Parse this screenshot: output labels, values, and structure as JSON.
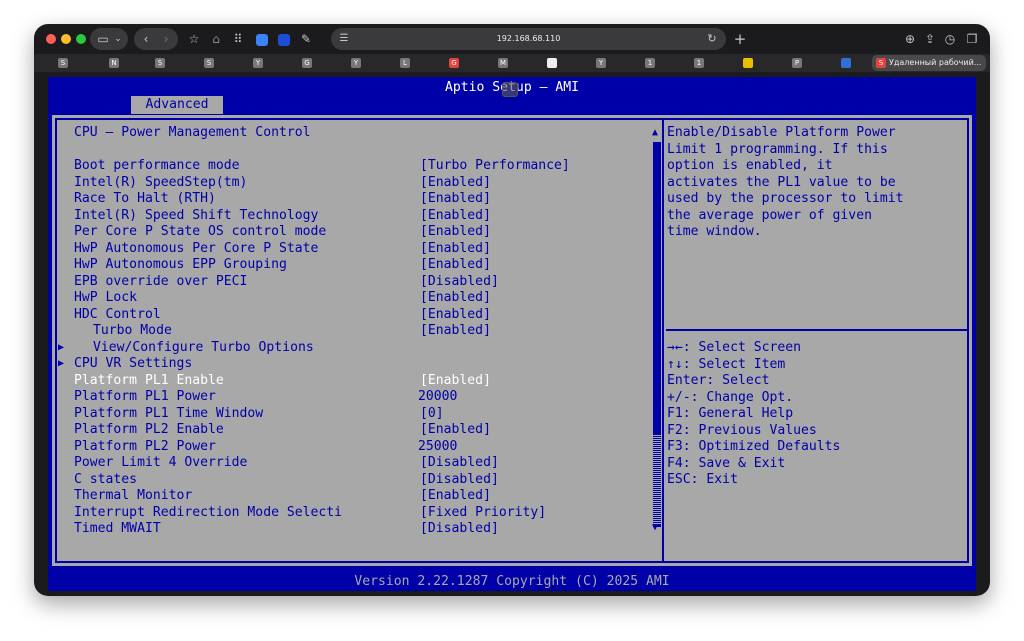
{
  "browser": {
    "url": "192.168.68.110",
    "tab_title": "Удаленный рабочий...",
    "favicons": [
      "S",
      "N",
      "S",
      "S",
      "Y",
      "G",
      "Y",
      "L",
      "G",
      "M",
      "",
      "Y",
      "1",
      "1",
      "",
      "P",
      ""
    ]
  },
  "bios": {
    "title": "Aptio Setup – AMI",
    "active_tab": "Advanced",
    "section_title": "CPU – Power Management Control",
    "items": [
      {
        "label": "Boot performance mode",
        "value": "[Turbo Performance]"
      },
      {
        "label": "Intel(R) SpeedStep(tm)",
        "value": "[Enabled]"
      },
      {
        "label": "Race To Halt (RTH)",
        "value": "[Enabled]"
      },
      {
        "label": "Intel(R) Speed Shift Technology",
        "value": "[Enabled]"
      },
      {
        "label": "Per Core P State OS control mode",
        "value": "[Enabled]"
      },
      {
        "label": "HwP Autonomous Per Core P State",
        "value": "[Enabled]"
      },
      {
        "label": "HwP Autonomous EPP Grouping",
        "value": "[Enabled]"
      },
      {
        "label": "EPB override over PECI",
        "value": "[Disabled]"
      },
      {
        "label": "HwP Lock",
        "value": "[Enabled]"
      },
      {
        "label": "HDC Control",
        "value": "[Enabled]"
      },
      {
        "label": "Turbo Mode",
        "value": "[Enabled]"
      },
      {
        "label": "View/Configure Turbo Options",
        "value": ""
      },
      {
        "label": "CPU VR Settings",
        "value": ""
      },
      {
        "label": "Platform PL1 Enable",
        "value": "[Enabled]"
      },
      {
        "label": "Platform PL1 Power",
        "value": "20000"
      },
      {
        "label": "Platform PL1 Time Window",
        "value": "[0]"
      },
      {
        "label": "Platform PL2 Enable",
        "value": "[Enabled]"
      },
      {
        "label": "Platform PL2 Power",
        "value": "25000"
      },
      {
        "label": "Power Limit 4 Override",
        "value": "[Disabled]"
      },
      {
        "label": "C states",
        "value": "[Disabled]"
      },
      {
        "label": "Thermal Monitor",
        "value": "[Enabled]"
      },
      {
        "label": "Interrupt Redirection Mode Selecti",
        "value": "[Fixed Priority]"
      },
      {
        "label": "Timed MWAIT",
        "value": "[Disabled]"
      }
    ],
    "help_lines": [
      "Enable/Disable Platform Power",
      "Limit 1 programming. If this",
      "option is enabled, it",
      "activates the PL1 value to be",
      "used by the processor to limit",
      "the average power of given",
      "time window."
    ],
    "keys": [
      "→←: Select Screen",
      "↑↓: Select Item",
      "Enter: Select",
      "+/-: Change Opt.",
      "F1: General Help",
      "F2: Previous Values",
      "F3: Optimized Defaults",
      "F4: Save & Exit",
      "ESC: Exit"
    ],
    "footer": "Version 2.22.1287 Copyright (C) 2025 AMI",
    "colors": {
      "blue": "#0000a8",
      "gray": "#a8a8a8",
      "white": "#ffffff"
    }
  }
}
